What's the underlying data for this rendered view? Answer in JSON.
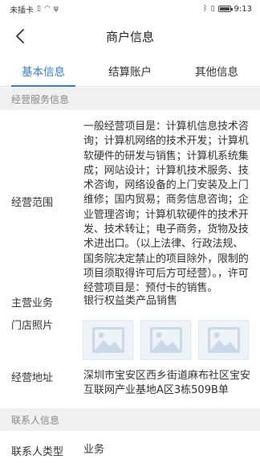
{
  "status_bar": {
    "carrier": "未插卡",
    "time": "9:13",
    "battery_level": 0.9
  },
  "header": {
    "title": "商户信息"
  },
  "tabs": [
    {
      "label": "基本信息",
      "active": true
    },
    {
      "label": "结算账户",
      "active": false
    },
    {
      "label": "其他信息",
      "active": false
    }
  ],
  "sections": {
    "business": {
      "title": "经营服务信息",
      "scope_label": "经营范围",
      "scope_value": "一般经营项目是：计算机信息技术咨询；计算机网络的技术开发；计算机软硬件的研发与销售；计算机系统集成；网站设计；计算机技术服务、技术咨询，网络设备的上门安装及上门维修；国内贸易；商务信息咨询；企业管理咨询；计算机软硬件的技术开发、技术转让；电子商务，货物及技术进出口。（以上法律、行政法规、国务院决定禁止的项目除外，限制的项目须取得许可后方可经营）。，许可经营项目是：预付卡的销售。",
      "main_business_label": "主营业务",
      "main_business_value": "银行权益类产品销售",
      "store_photos_label": "门店照片",
      "address_label": "经营地址",
      "address_value": "深圳市宝安区西乡街道麻布社区宝安互联网产业基地A区3栋509B单"
    },
    "contact": {
      "title": "联系人信息",
      "type_label": "联系人类型",
      "type_value": "业务"
    }
  },
  "icons": {
    "back": "chevron-left-icon",
    "photo": "image-placeholder-icon"
  },
  "colors": {
    "accent": "#2f7fd6",
    "section_bg": "#f0f0f0",
    "photo_placeholder": "#c9d9ea"
  }
}
